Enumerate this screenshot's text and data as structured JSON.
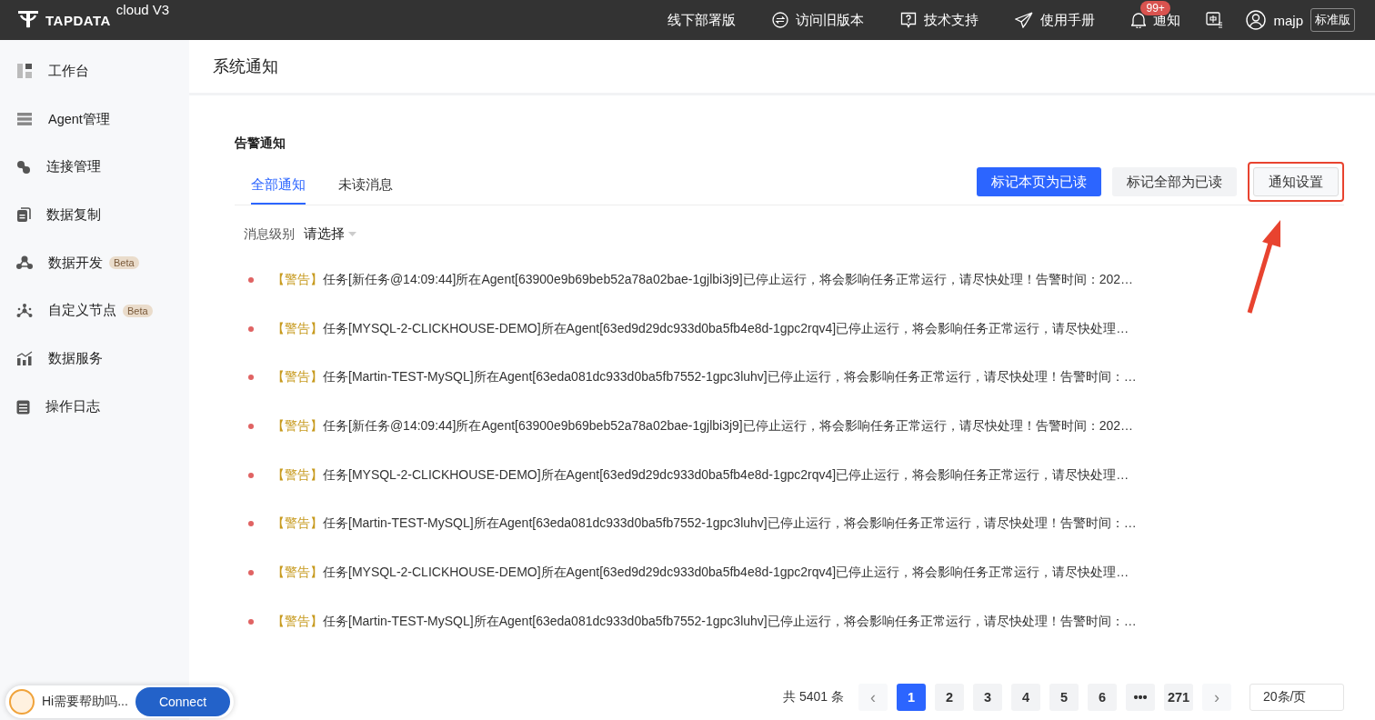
{
  "topbar": {
    "logo": "TAPDATA",
    "product": "cloud V3",
    "links": [
      {
        "kind": "plain",
        "label": "线下部署版"
      },
      {
        "kind": "switch",
        "label": "访问旧版本"
      },
      {
        "kind": "help",
        "label": "技术支持"
      },
      {
        "kind": "send",
        "label": "使用手册"
      }
    ],
    "notice": {
      "label": "通知",
      "badge": "99+"
    },
    "user": "majp",
    "plan": "标准版"
  },
  "sidebar": {
    "items": [
      {
        "kind": "dashboard",
        "label": "工作台"
      },
      {
        "kind": "server",
        "label": "Agent管理"
      },
      {
        "kind": "link",
        "label": "连接管理"
      },
      {
        "kind": "copy",
        "label": "数据复制"
      },
      {
        "kind": "dev",
        "label": "数据开发",
        "badge": "Beta"
      },
      {
        "kind": "nodes",
        "label": "自定义节点",
        "badge": "Beta"
      },
      {
        "kind": "chart",
        "label": "数据服务"
      },
      {
        "kind": "log",
        "label": "操作日志"
      }
    ]
  },
  "page_title": "系统通知",
  "section_title": "告警通知",
  "tabs": [
    {
      "label": "全部通知",
      "selected": true
    },
    {
      "label": "未读消息",
      "selected": false
    }
  ],
  "buttons": [
    {
      "kind": "primary",
      "label": "标记本页为已读"
    },
    {
      "kind": "plain",
      "label": "标记全部为已读"
    },
    {
      "kind": "outline",
      "label": "通知设置",
      "highlighted": true
    }
  ],
  "filter": {
    "label": "消息级别",
    "placeholder": "请选择"
  },
  "notifications": [
    {
      "unread": true,
      "level": "【警告】",
      "text": "任务[新任务@14:09:44]所在Agent[63900e9b69beb52a78a02bae-1gjlbi3j9]已停止运行，将会影响任务正常运行，请尽快处理！告警时间：202…"
    },
    {
      "unread": true,
      "level": "【警告】",
      "text": "任务[MYSQL-2-CLICKHOUSE-DEMO]所在Agent[63ed9d29dc933d0ba5fb4e8d-1gpc2rqv4]已停止运行，将会影响任务正常运行，请尽快处理…"
    },
    {
      "unread": true,
      "level": "【警告】",
      "text": "任务[Martin-TEST-MySQL]所在Agent[63eda081dc933d0ba5fb7552-1gpc3luhv]已停止运行，将会影响任务正常运行，请尽快处理！告警时间：…"
    },
    {
      "unread": true,
      "level": "【警告】",
      "text": "任务[新任务@14:09:44]所在Agent[63900e9b69beb52a78a02bae-1gjlbi3j9]已停止运行，将会影响任务正常运行，请尽快处理！告警时间：202…"
    },
    {
      "unread": true,
      "level": "【警告】",
      "text": "任务[MYSQL-2-CLICKHOUSE-DEMO]所在Agent[63ed9d29dc933d0ba5fb4e8d-1gpc2rqv4]已停止运行，将会影响任务正常运行，请尽快处理…"
    },
    {
      "unread": true,
      "level": "【警告】",
      "text": "任务[Martin-TEST-MySQL]所在Agent[63eda081dc933d0ba5fb7552-1gpc3luhv]已停止运行，将会影响任务正常运行，请尽快处理！告警时间：…"
    },
    {
      "unread": true,
      "level": "【警告】",
      "text": "任务[MYSQL-2-CLICKHOUSE-DEMO]所在Agent[63ed9d29dc933d0ba5fb4e8d-1gpc2rqv4]已停止运行，将会影响任务正常运行，请尽快处理…"
    },
    {
      "unread": true,
      "level": "【警告】",
      "text": "任务[Martin-TEST-MySQL]所在Agent[63eda081dc933d0ba5fb7552-1gpc3luhv]已停止运行，将会影响任务正常运行，请尽快处理！告警时间：…"
    }
  ],
  "pagination": {
    "total": "共 5401 条",
    "prev": "‹",
    "next": "›",
    "pages": [
      {
        "label": "1",
        "selected": true
      },
      {
        "label": "2",
        "selected": false
      },
      {
        "label": "3",
        "selected": false
      },
      {
        "label": "4",
        "selected": false
      },
      {
        "label": "5",
        "selected": false
      },
      {
        "label": "6",
        "selected": false
      },
      {
        "label": "•••",
        "selected": false
      },
      {
        "label": "271",
        "selected": false
      }
    ],
    "page_size": "20条/页"
  },
  "chat": {
    "text": "Hi需要帮助吗...",
    "button": "Connect"
  }
}
